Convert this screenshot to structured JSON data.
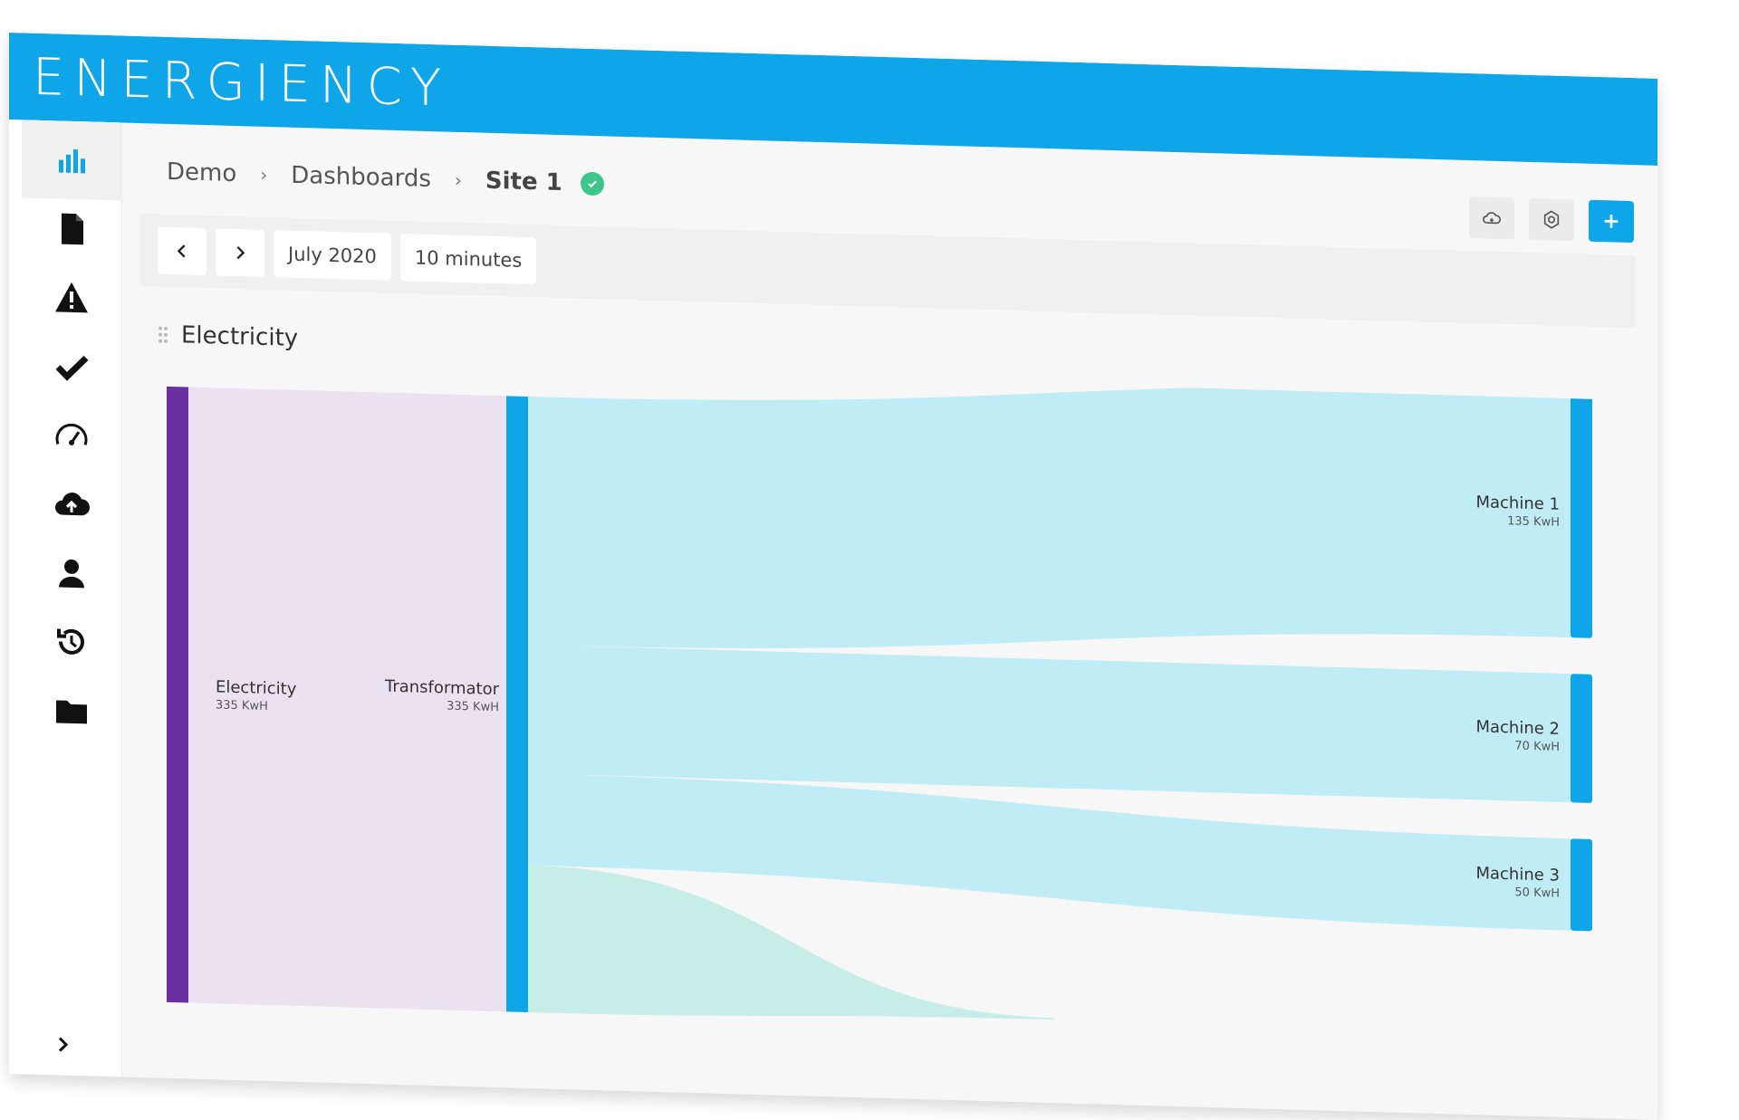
{
  "app": {
    "logo_text": "ENERGIENCY"
  },
  "colors": {
    "brand": "#0ea5e9",
    "source_node": "#6b2fa3",
    "node": "#0ea5e9",
    "status_ok": "#3cc68a"
  },
  "sidebar": {
    "items": [
      {
        "icon": "bar-chart-icon",
        "active": true
      },
      {
        "icon": "document-icon"
      },
      {
        "icon": "warning-icon"
      },
      {
        "icon": "check-icon"
      },
      {
        "icon": "gauge-icon"
      },
      {
        "icon": "cloud-upload-icon"
      },
      {
        "icon": "user-icon"
      },
      {
        "icon": "history-icon"
      },
      {
        "icon": "folder-icon"
      }
    ],
    "expand_icon": "chevron-right-icon"
  },
  "breadcrumb": {
    "items": [
      "Demo",
      "Dashboards",
      "Site 1"
    ],
    "status": "ok"
  },
  "actions": [
    {
      "icon": "cloud-icon"
    },
    {
      "icon": "settings-icon"
    },
    {
      "icon": "plus-icon"
    }
  ],
  "toolbar": {
    "period": "July 2020",
    "interval": "10 minutes"
  },
  "widget": {
    "title": "Electricity"
  },
  "chart_data": {
    "type": "sankey",
    "unit": "KwH",
    "nodes": [
      {
        "id": "electricity",
        "label": "Electricity",
        "value_label": "335 KwH",
        "value": 335
      },
      {
        "id": "transformator",
        "label": "Transformator",
        "value_label": "335 KwH",
        "value": 335
      },
      {
        "id": "machine1",
        "label": "Machine 1",
        "value_label": "135 KwH",
        "value": 135
      },
      {
        "id": "machine2",
        "label": "Machine 2",
        "value_label": "70 KwH",
        "value": 70
      },
      {
        "id": "machine3",
        "label": "Machine 3",
        "value_label": "50 KwH",
        "value": 50
      }
    ],
    "links": [
      {
        "source": "electricity",
        "target": "transformator",
        "value": 335
      },
      {
        "source": "transformator",
        "target": "machine1",
        "value": 135
      },
      {
        "source": "transformator",
        "target": "machine2",
        "value": 70
      },
      {
        "source": "transformator",
        "target": "machine3",
        "value": 50
      },
      {
        "source": "transformator",
        "target": null,
        "value": 80
      }
    ]
  }
}
